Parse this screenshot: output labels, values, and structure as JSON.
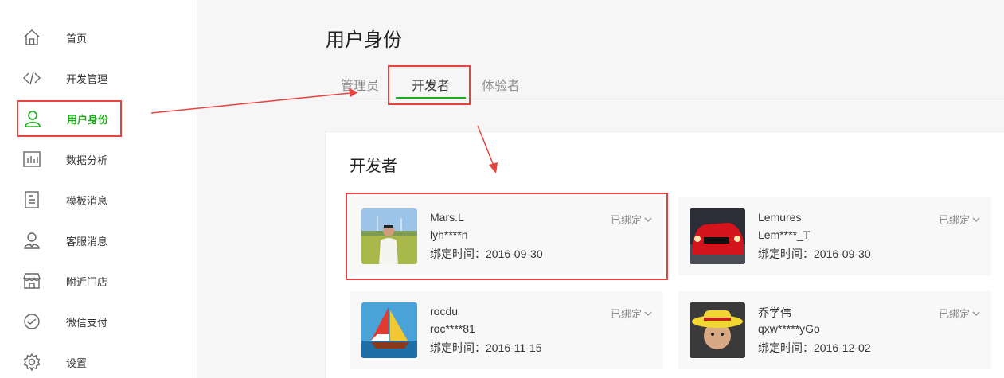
{
  "sidebar": {
    "items": [
      {
        "label": "首页",
        "icon": "home-icon"
      },
      {
        "label": "开发管理",
        "icon": "code-icon"
      },
      {
        "label": "用户身份",
        "icon": "user-icon",
        "active": true
      },
      {
        "label": "数据分析",
        "icon": "chart-icon"
      },
      {
        "label": "模板消息",
        "icon": "document-icon"
      },
      {
        "label": "客服消息",
        "icon": "customer-service-icon"
      },
      {
        "label": "附近门店",
        "icon": "store-icon"
      },
      {
        "label": "微信支付",
        "icon": "payment-icon"
      },
      {
        "label": "设置",
        "icon": "gear-icon"
      }
    ]
  },
  "header": {
    "title": "用户身份"
  },
  "tabs": [
    {
      "label": "管理员"
    },
    {
      "label": "开发者",
      "active": true
    },
    {
      "label": "体验者"
    }
  ],
  "panel": {
    "title": "开发者",
    "members": [
      {
        "name": "Mars.L",
        "account": "lyh****n",
        "bind_time": "绑定时间：2016-09-30",
        "status": "已绑定",
        "avatar": "person-outdoor-avatar"
      },
      {
        "name": "Lemures",
        "account": "Lem****_T",
        "bind_time": "绑定时间：2016-09-30",
        "status": "已绑定",
        "avatar": "red-car-avatar"
      },
      {
        "name": "rocdu",
        "account": "roc****81",
        "bind_time": "绑定时间：2016-11-15",
        "status": "已绑定",
        "avatar": "sailboat-avatar"
      },
      {
        "name": "乔学伟",
        "account": "qxw*****yGo",
        "bind_time": "绑定时间：2016-12-02",
        "status": "已绑定",
        "avatar": "straw-hat-avatar"
      }
    ]
  },
  "colors": {
    "accent": "#1aad19",
    "annotation": "#e64340",
    "muted": "#8d8d8d"
  }
}
